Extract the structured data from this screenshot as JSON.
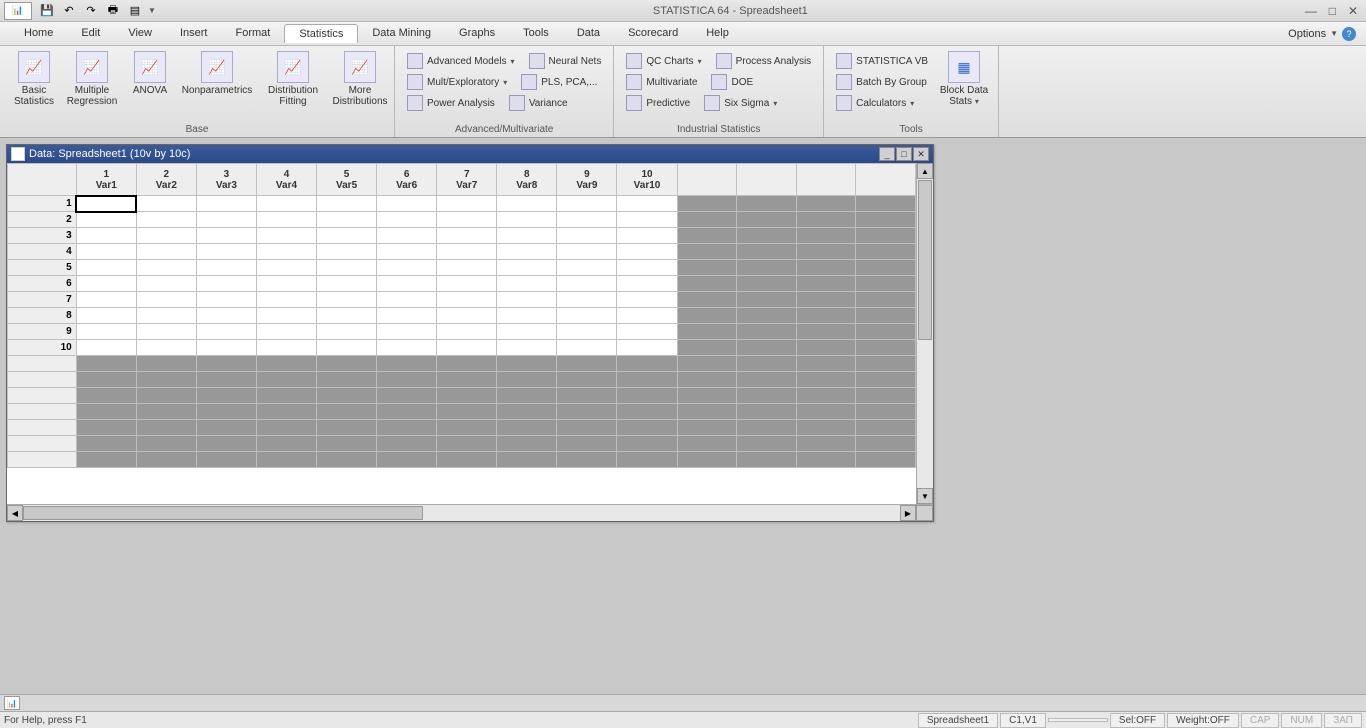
{
  "app": {
    "title": "STATISTICA 64 - Spreadsheet1"
  },
  "qat": {
    "save": "💾",
    "undo": "↶",
    "redo": "↷",
    "print": "🖶",
    "append": "▤"
  },
  "menu": {
    "items": [
      "Home",
      "Edit",
      "View",
      "Insert",
      "Format",
      "Statistics",
      "Data Mining",
      "Graphs",
      "Tools",
      "Data",
      "Scorecard",
      "Help"
    ],
    "active_index": 5,
    "options": "Options"
  },
  "ribbon": {
    "base": {
      "label": "Base",
      "buttons": [
        {
          "l1": "Basic",
          "l2": "Statistics"
        },
        {
          "l1": "Multiple",
          "l2": "Regression"
        },
        {
          "l1": "ANOVA",
          "l2": ""
        },
        {
          "l1": "Nonparametrics",
          "l2": ""
        },
        {
          "l1": "Distribution",
          "l2": "Fitting"
        },
        {
          "l1": "More",
          "l2": "Distributions"
        }
      ]
    },
    "adv": {
      "label": "Advanced/Multivariate",
      "rows": [
        [
          {
            "t": "Advanced Models",
            "d": true
          },
          {
            "t": "Neural Nets",
            "d": false
          }
        ],
        [
          {
            "t": "Mult/Exploratory",
            "d": true
          },
          {
            "t": "PLS, PCA,...",
            "d": false
          }
        ],
        [
          {
            "t": "Power Analysis",
            "d": false
          },
          {
            "t": "Variance",
            "d": false
          }
        ]
      ]
    },
    "ind": {
      "label": "Industrial Statistics",
      "rows": [
        [
          {
            "t": "QC Charts",
            "d": true
          },
          {
            "t": "Process Analysis",
            "d": false
          }
        ],
        [
          {
            "t": "Multivariate",
            "d": false
          },
          {
            "t": "DOE",
            "d": false
          }
        ],
        [
          {
            "t": "Predictive",
            "d": false
          },
          {
            "t": "Six Sigma",
            "d": true
          }
        ]
      ]
    },
    "tools": {
      "label": "Tools",
      "col": [
        {
          "t": "STATISTICA VB",
          "d": false
        },
        {
          "t": "Batch By Group",
          "d": false
        },
        {
          "t": "Calculators",
          "d": true
        }
      ],
      "block": {
        "l1": "Block Data",
        "l2": "Stats"
      }
    }
  },
  "sheet": {
    "title": "Data: Spreadsheet1 (10v by 10c)",
    "cols": [
      {
        "n": "1",
        "v": "Var1",
        "b": true
      },
      {
        "n": "2",
        "v": "Var2"
      },
      {
        "n": "3",
        "v": "Var3"
      },
      {
        "n": "4",
        "v": "Var4"
      },
      {
        "n": "5",
        "v": "Var5"
      },
      {
        "n": "6",
        "v": "Var6"
      },
      {
        "n": "7",
        "v": "Var7"
      },
      {
        "n": "8",
        "v": "Var8"
      },
      {
        "n": "9",
        "v": "Var9"
      },
      {
        "n": "10",
        "v": "Var10"
      }
    ],
    "rows": [
      "1",
      "2",
      "3",
      "4",
      "5",
      "6",
      "7",
      "8",
      "9",
      "10"
    ],
    "total_cols": 14,
    "grey_rows": 7
  },
  "status": {
    "help": "For Help, press F1",
    "sheet": "Spreadsheet1",
    "cell": "C1,V1",
    "sel": "Sel:OFF",
    "weight": "Weight:OFF",
    "cap": "CAP",
    "num": "NUM",
    "rec": "ЗАП"
  }
}
